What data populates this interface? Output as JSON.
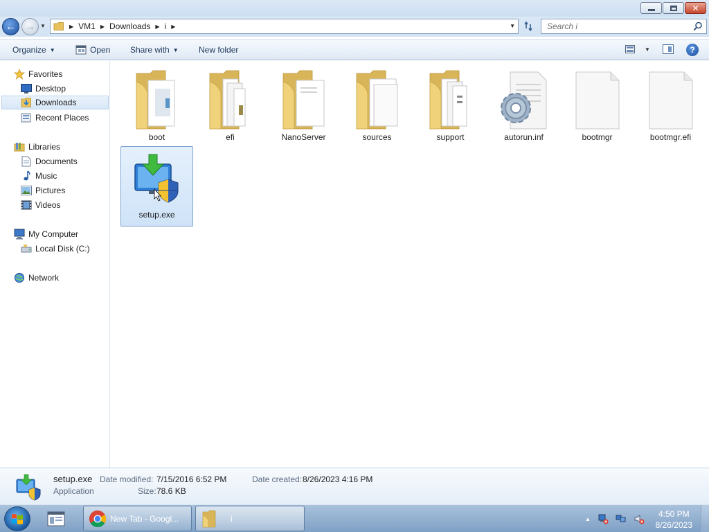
{
  "window": {
    "controls": {
      "minimize": "minimize",
      "maximize": "restore",
      "close": "✕"
    }
  },
  "address": {
    "crumbs": [
      "VM1",
      "Downloads",
      "i"
    ]
  },
  "search": {
    "placeholder": "Search i"
  },
  "toolbar": {
    "organize": "Organize",
    "open": "Open",
    "share_with": "Share with",
    "new_folder": "New folder"
  },
  "nav": {
    "favorites": "Favorites",
    "desktop": "Desktop",
    "downloads": "Downloads",
    "recent_places": "Recent Places",
    "libraries": "Libraries",
    "documents": "Documents",
    "music": "Music",
    "pictures": "Pictures",
    "videos": "Videos",
    "my_computer": "My Computer",
    "local_disk": "Local Disk (C:)",
    "network": "Network"
  },
  "files": {
    "boot": "boot",
    "efi": "efi",
    "nanoserver": "NanoServer",
    "sources": "sources",
    "support": "support",
    "autorun": "autorun.inf",
    "bootmgr": "bootmgr",
    "bootmgr_efi": "bootmgr.efi",
    "setup": "setup.exe"
  },
  "details": {
    "name": "setup.exe",
    "type": "Application",
    "date_modified_label": "Date modified:",
    "date_modified": "7/15/2016 6:52 PM",
    "date_created_label": "Date created:",
    "date_created": "8/26/2023 4:16 PM",
    "size_label": "Size:",
    "size": "78.6 KB"
  },
  "taskbar": {
    "chrome_label": "New Tab - Googl...",
    "explorer_label": "i",
    "time": "4:50 PM",
    "date": "8/26/2023"
  },
  "colors": {
    "accent": "#1d4f9d",
    "selection": "#cfe3f8",
    "folder": "#f0d27a"
  }
}
